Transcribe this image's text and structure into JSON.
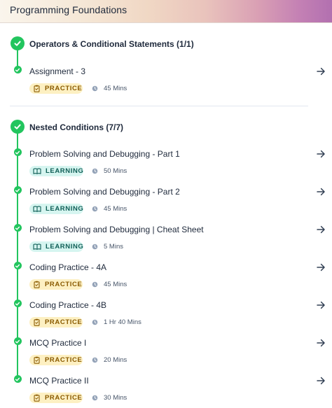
{
  "header": {
    "title": "Programming Foundations"
  },
  "sections": [
    {
      "title": "Operators & Conditional Statements (1/1)",
      "items": [
        {
          "title": "Assignment - 3",
          "type": "PRACTICE",
          "duration": "45 Mins"
        }
      ]
    },
    {
      "title": "Nested Conditions (7/7)",
      "items": [
        {
          "title": "Problem Solving and Debugging - Part 1",
          "type": "LEARNING",
          "duration": "50 Mins"
        },
        {
          "title": "Problem Solving and Debugging - Part 2",
          "type": "LEARNING",
          "duration": "45 Mins"
        },
        {
          "title": "Problem Solving and Debugging | Cheat Sheet",
          "type": "LEARNING",
          "duration": "5 Mins"
        },
        {
          "title": "Coding Practice - 4A",
          "type": "PRACTICE",
          "duration": "45 Mins"
        },
        {
          "title": "Coding Practice - 4B",
          "type": "PRACTICE",
          "duration": "1 Hr 40 Mins"
        },
        {
          "title": "MCQ Practice I",
          "type": "PRACTICE",
          "duration": "20 Mins"
        },
        {
          "title": "MCQ Practice II",
          "type": "PRACTICE",
          "duration": "30 Mins"
        }
      ]
    }
  ],
  "icons": {
    "completed": "check-circle-icon",
    "practice": "clipboard-icon",
    "learning": "book-open-icon",
    "duration": "clock-icon",
    "open": "arrow-right-icon"
  },
  "colors": {
    "completed": "#22c55e",
    "practice_bg": "#fdf0c2",
    "practice_text": "#8a5a00",
    "learning_bg": "#d6f5f0",
    "learning_text": "#0f5e56"
  }
}
